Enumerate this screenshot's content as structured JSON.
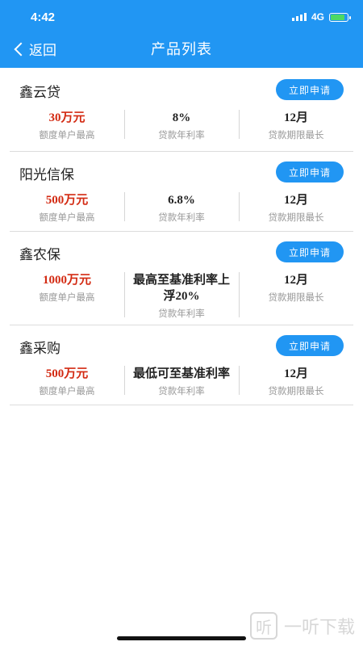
{
  "status": {
    "time": "4:42",
    "network": "4G"
  },
  "nav": {
    "back_label": "返回",
    "title": "产品列表"
  },
  "products": [
    {
      "name": "鑫云贷",
      "apply_label": "立即申请",
      "limit_value": "30万元",
      "limit_label": "额度单户最高",
      "rate_value": "8%",
      "rate_label": "贷款年利率",
      "term_value": "12月",
      "term_label": "贷款期限最长"
    },
    {
      "name": "阳光信保",
      "apply_label": "立即申请",
      "limit_value": "500万元",
      "limit_label": "额度单户最高",
      "rate_value": "6.8%",
      "rate_label": "贷款年利率",
      "term_value": "12月",
      "term_label": "贷款期限最长"
    },
    {
      "name": "鑫农保",
      "apply_label": "立即申请",
      "limit_value": "1000万元",
      "limit_label": "额度单户最高",
      "rate_value": "最高至基准利率上浮20%",
      "rate_label": "贷款年利率",
      "term_value": "12月",
      "term_label": "贷款期限最长"
    },
    {
      "name": "鑫采购",
      "apply_label": "立即申请",
      "limit_value": "500万元",
      "limit_label": "额度单户最高",
      "rate_value": "最低可至基准利率",
      "rate_label": "贷款年利率",
      "term_value": "12月",
      "term_label": "贷款期限最长"
    }
  ],
  "watermark": {
    "logo": "听",
    "text": "一听下载"
  },
  "colors": {
    "primary": "#2196f3",
    "amount_red": "#d32a12"
  }
}
